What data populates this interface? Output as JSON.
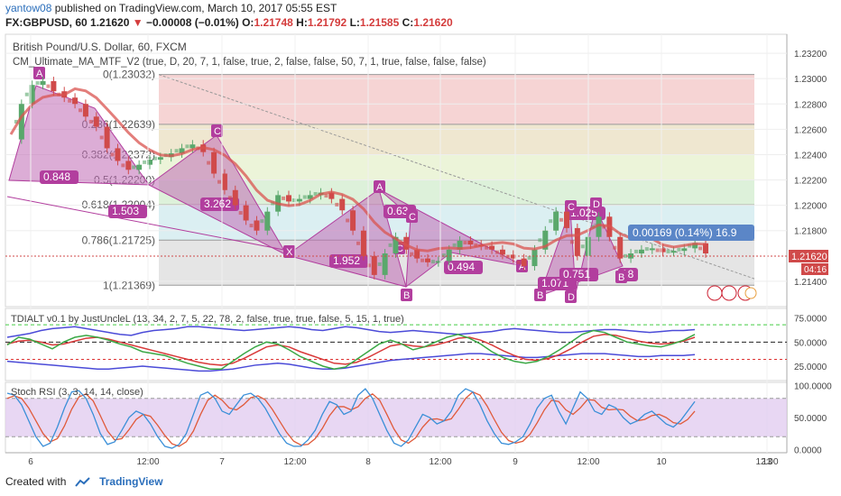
{
  "header": {
    "author": "yantow08",
    "published_text": "published on TradingView.com, March 10, 2017 05:55 EST",
    "symbol": "FX:GBPUSD, 60",
    "last": "1.21620",
    "change_arrow": "▼",
    "change": "−0.00008 (−0.01%)",
    "o_label": "O:",
    "o": "1.21748",
    "h_label": "H:",
    "h": "1.21792",
    "l_label": "L:",
    "l": "1.21585",
    "c_label": "C:",
    "c": "1.21620"
  },
  "chart_data": {
    "type": "candlestick",
    "title": "British Pound/U.S. Dollar, 60, FXCM",
    "indicator": "CM_Ultimate_MA_MTF_V2 (true, D, 20, 7, 1, false, true, 2, false, false, 50, 7, 1, true, false, false, false)",
    "ylim": [
      1.212,
      1.2335
    ],
    "y_ticks": [
      "1.23200",
      "1.23000",
      "1.22800",
      "1.22600",
      "1.22400",
      "1.22200",
      "1.22000",
      "1.21800",
      "1.21400"
    ],
    "x_labels": [
      "6",
      "12:00",
      "7",
      "12:00",
      "8",
      "12:00",
      "9",
      "12:00",
      "10",
      "12:00",
      "13"
    ],
    "price_label": "1.21620",
    "countdown": "04:16",
    "measure_label": "0.00169 (0.14%) 16.9",
    "close_path": [
      [
        0,
        1.2252
      ],
      [
        6,
        1.228
      ],
      [
        12,
        1.2295
      ],
      [
        18,
        1.2298
      ],
      [
        24,
        1.229
      ],
      [
        30,
        1.2285
      ],
      [
        36,
        1.228
      ],
      [
        42,
        1.227
      ],
      [
        48,
        1.2262
      ],
      [
        54,
        1.2245
      ],
      [
        60,
        1.2235
      ],
      [
        66,
        1.2228
      ],
      [
        72,
        1.2232
      ],
      [
        78,
        1.2236
      ],
      [
        84,
        1.2238
      ],
      [
        90,
        1.2241
      ],
      [
        96,
        1.2245
      ],
      [
        102,
        1.2248
      ],
      [
        108,
        1.2242
      ],
      [
        114,
        1.2225
      ],
      [
        120,
        1.2212
      ],
      [
        126,
        1.22
      ],
      [
        132,
        1.2188
      ],
      [
        138,
        1.218
      ],
      [
        144,
        1.2195
      ],
      [
        150,
        1.2208
      ],
      [
        156,
        1.2203
      ],
      [
        162,
        1.2205
      ],
      [
        168,
        1.2208
      ],
      [
        174,
        1.221
      ],
      [
        180,
        1.2205
      ],
      [
        186,
        1.2196
      ],
      [
        192,
        1.218
      ],
      [
        198,
        1.216
      ],
      [
        204,
        1.2145
      ],
      [
        210,
        1.2162
      ],
      [
        216,
        1.2175
      ],
      [
        222,
        1.2165
      ],
      [
        228,
        1.2158
      ],
      [
        234,
        1.2155
      ],
      [
        240,
        1.2156
      ],
      [
        246,
        1.2165
      ],
      [
        252,
        1.2172
      ],
      [
        258,
        1.2169
      ],
      [
        264,
        1.2168
      ],
      [
        270,
        1.2165
      ],
      [
        276,
        1.2161
      ],
      [
        282,
        1.2158
      ],
      [
        288,
        1.2152
      ],
      [
        294,
        1.2165
      ],
      [
        300,
        1.218
      ],
      [
        306,
        1.2195
      ],
      [
        312,
        1.2182
      ],
      [
        318,
        1.216
      ],
      [
        324,
        1.2175
      ],
      [
        330,
        1.2191
      ],
      [
        336,
        1.2175
      ],
      [
        342,
        1.2158
      ],
      [
        348,
        1.2162
      ],
      [
        354,
        1.2165
      ],
      [
        360,
        1.2166
      ],
      [
        366,
        1.2163
      ],
      [
        372,
        1.2164
      ],
      [
        378,
        1.2166
      ],
      [
        384,
        1.217
      ],
      [
        390,
        1.2162
      ]
    ],
    "fib_levels": [
      {
        "label": "0(1.23032)",
        "value": 1.23032
      },
      {
        "label": "0.236(1.22639)",
        "value": 1.22639
      },
      {
        "label": "0.382(1.22372)",
        "value": 1.224
      },
      {
        "label": "0.5(1.22200)",
        "value": 1.222
      },
      {
        "label": "0.618(1.22004)",
        "value": 1.22004
      },
      {
        "label": "0.786(1.21725)",
        "value": 1.21725
      },
      {
        "label": "1(1.21369)",
        "value": 1.21369
      }
    ],
    "fib_colors": [
      "#f3c6c6",
      "#eadfc0",
      "#e6f0cc",
      "#d2eccd",
      "#cfe9ee",
      "#dcdcdc",
      "#cfd0ef"
    ],
    "harmonic_labels": [
      "0.848",
      "1.503",
      "3.262",
      "1.952",
      "0.494",
      "0.63",
      "1.025",
      "1.071",
      "0.751",
      "18"
    ],
    "point_labels": [
      "A",
      "C",
      "X",
      "B",
      "C",
      "A",
      "C",
      "D",
      "A",
      "B",
      "D",
      "B",
      "C"
    ]
  },
  "tdi": {
    "title": "TDIALT v0.1 by JustUncleL (13, 34, 2, 7, 5, 22, 78, 2, false, true, true, false, 5, 15, 1, true)",
    "y_ticks": [
      "75.0000",
      "50.0000",
      "25.0000"
    ],
    "ylim": [
      10,
      85
    ],
    "green": [
      47,
      55,
      53,
      48,
      43,
      50,
      55,
      57,
      55,
      52,
      48,
      45,
      40,
      38,
      36,
      32,
      28,
      25,
      22,
      22,
      30,
      38,
      45,
      50,
      48,
      42,
      35,
      30,
      25,
      22,
      24,
      32,
      40,
      48,
      52,
      48,
      42,
      45,
      50,
      55,
      58,
      54,
      48,
      40,
      34,
      30,
      28,
      30,
      35,
      42,
      50,
      58,
      62,
      60,
      55,
      50,
      48,
      46,
      45,
      48,
      52,
      58
    ],
    "red": [
      48,
      51,
      52,
      50,
      47,
      48,
      51,
      54,
      55,
      53,
      50,
      47,
      44,
      41,
      38,
      35,
      32,
      29,
      27,
      26,
      28,
      33,
      39,
      45,
      47,
      45,
      40,
      36,
      32,
      28,
      27,
      29,
      34,
      40,
      46,
      48,
      46,
      45,
      47,
      50,
      54,
      55,
      52,
      47,
      41,
      36,
      32,
      31,
      33,
      37,
      43,
      50,
      56,
      58,
      57,
      54,
      51,
      49,
      48,
      49,
      51,
      55
    ],
    "blue_upper": [
      55,
      57,
      59,
      62,
      64,
      65,
      66,
      64,
      62,
      60,
      58,
      57,
      60,
      62,
      63,
      64,
      66,
      66,
      65,
      64,
      63,
      62,
      63,
      64,
      65,
      66,
      65,
      63,
      62,
      64,
      66,
      65,
      63,
      61,
      60,
      61,
      62,
      61,
      60,
      59,
      58,
      59,
      60,
      61,
      63,
      64,
      63,
      62,
      61,
      60,
      60,
      61,
      62,
      63,
      63,
      62,
      61,
      60,
      61,
      62,
      62,
      63
    ],
    "blue_lower": [
      30,
      29,
      28,
      27,
      26,
      25,
      24,
      23,
      22,
      22,
      23,
      24,
      25,
      24,
      23,
      22,
      21,
      20,
      20,
      21,
      22,
      24,
      26,
      27,
      28,
      27,
      25,
      23,
      22,
      22,
      23,
      25,
      27,
      29,
      31,
      32,
      33,
      34,
      35,
      36,
      37,
      38,
      38,
      37,
      36,
      35,
      34,
      34,
      35,
      36,
      37,
      38,
      38,
      38,
      37,
      36,
      35,
      35,
      36,
      36,
      36,
      37
    ]
  },
  "stoch": {
    "title": "Stoch RSI (3, 3, 14, 14, close)",
    "y_ticks": [
      "100.0000",
      "50.0000",
      "0.0000"
    ],
    "ylim": [
      -5,
      105
    ],
    "k": [
      88,
      85,
      70,
      45,
      20,
      5,
      10,
      35,
      65,
      90,
      92,
      80,
      55,
      25,
      8,
      12,
      30,
      50,
      60,
      55,
      40,
      20,
      5,
      2,
      8,
      25,
      55,
      85,
      90,
      80,
      60,
      55,
      70,
      85,
      88,
      80,
      65,
      45,
      25,
      10,
      5,
      5,
      15,
      30,
      55,
      75,
      70,
      55,
      60,
      85,
      95,
      80,
      55,
      30,
      10,
      5,
      15,
      35,
      55,
      50,
      40,
      45,
      60,
      85,
      95,
      90,
      70,
      45,
      25,
      10,
      8,
      12,
      20,
      40,
      65,
      80,
      85,
      60,
      40,
      65,
      90,
      80,
      60,
      55,
      70,
      65,
      50,
      40,
      45,
      55,
      60,
      50,
      40,
      35,
      45,
      60,
      75
    ],
    "d": [
      80,
      84,
      80,
      65,
      45,
      25,
      12,
      17,
      37,
      63,
      82,
      87,
      76,
      53,
      29,
      15,
      17,
      31,
      47,
      55,
      52,
      38,
      22,
      9,
      5,
      12,
      29,
      55,
      77,
      85,
      77,
      65,
      62,
      70,
      81,
      84,
      78,
      63,
      45,
      27,
      13,
      7,
      8,
      17,
      33,
      53,
      67,
      67,
      62,
      67,
      80,
      87,
      77,
      55,
      32,
      15,
      10,
      18,
      35,
      47,
      48,
      45,
      48,
      63,
      80,
      90,
      85,
      68,
      47,
      27,
      14,
      10,
      13,
      24,
      42,
      62,
      77,
      75,
      62,
      55,
      65,
      78,
      77,
      66,
      62,
      63,
      62,
      52,
      45,
      47,
      53,
      55,
      50,
      42,
      40,
      47,
      60
    ]
  },
  "footer": {
    "created_with": "Created with",
    "brand": "TradingView"
  },
  "colors": {
    "up": "#5aa86c",
    "down": "#d04a4a",
    "ma": "#d9534f",
    "harmonic": "#b23e9e",
    "tdi_green": "#3aa845",
    "tdi_red": "#d83a3a",
    "tdi_blue": "#4b4bd8",
    "stoch_k": "#3a8fd8",
    "stoch_d": "#e05a3a"
  }
}
